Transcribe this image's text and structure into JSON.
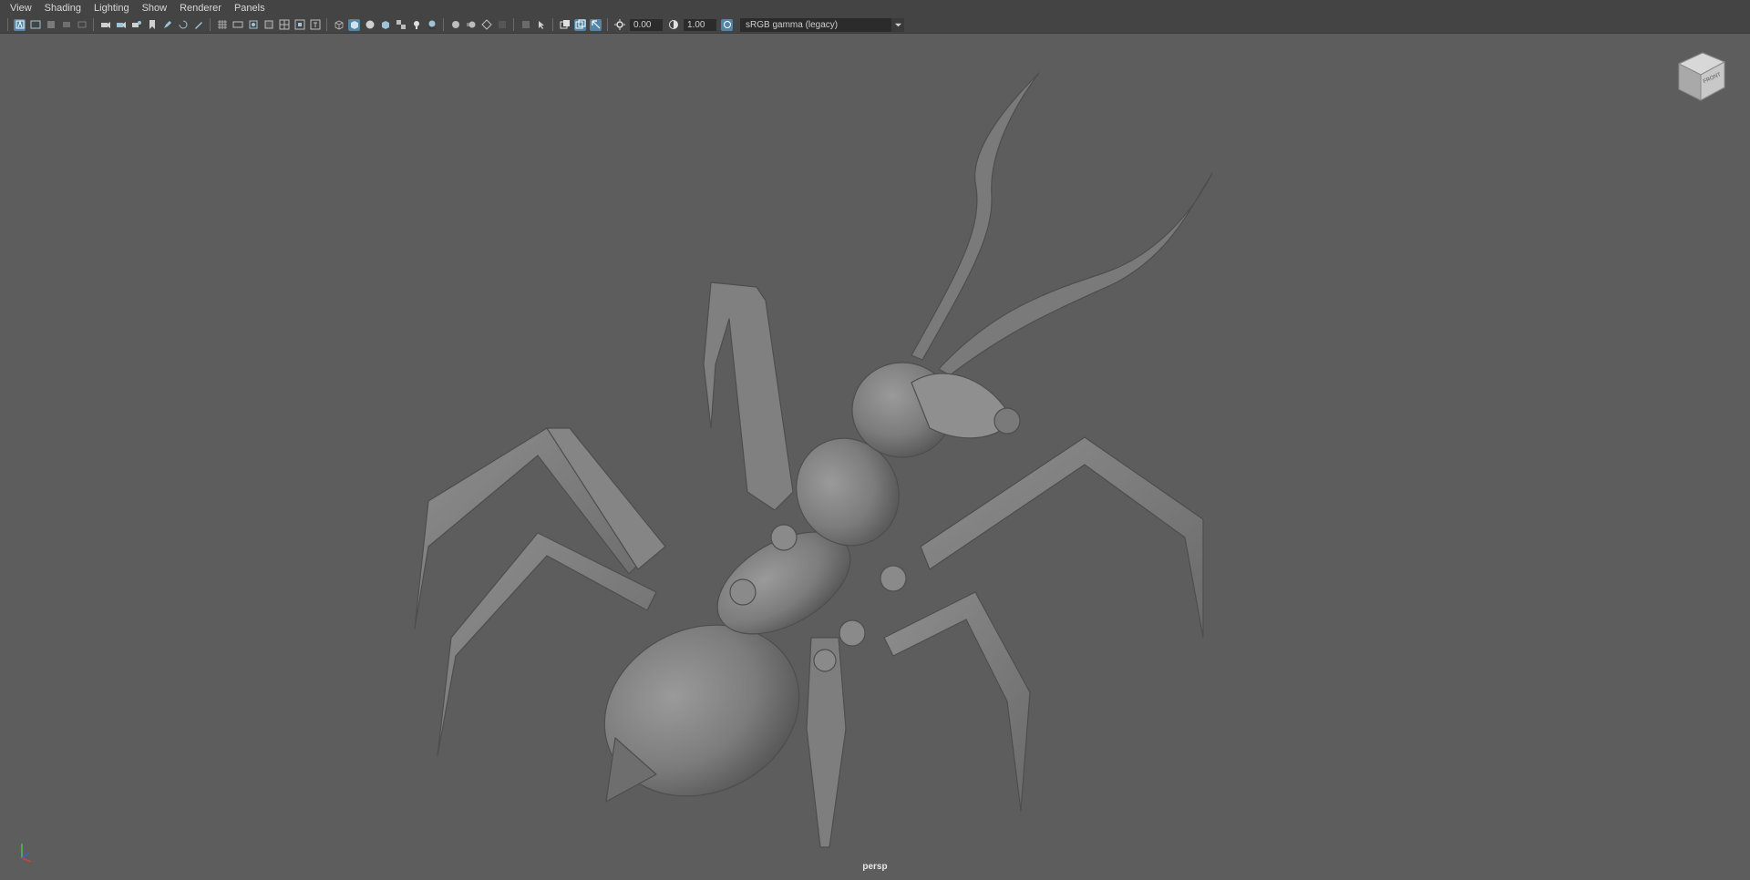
{
  "menu": {
    "items": [
      "View",
      "Shading",
      "Lighting",
      "Show",
      "Renderer",
      "Panels"
    ]
  },
  "toolbar": {
    "exposure_value": "0.00",
    "gamma_value": "1.00",
    "color_space": "sRGB gamma (legacy)"
  },
  "viewport": {
    "camera_label": "persp",
    "viewcube_face": "FRONT"
  },
  "colors": {
    "accent": "#5285a6",
    "viewport_bg": "#5d5d5d",
    "panel_bg": "#444444"
  }
}
